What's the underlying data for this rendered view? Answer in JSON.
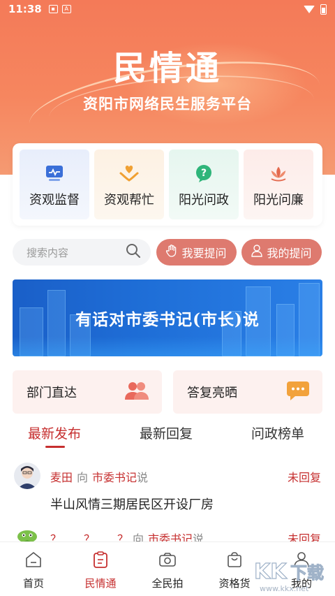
{
  "status_bar": {
    "time": "11:38",
    "icon_a": "A"
  },
  "hero": {
    "title": "民情通",
    "subtitle": "资阳市网络民生服务平台"
  },
  "services": [
    {
      "label": "资观监督",
      "icon": "monitor-wave-icon",
      "color": "#3a6fd8"
    },
    {
      "label": "资观帮忙",
      "icon": "heart-hands-icon",
      "color": "#f0a033"
    },
    {
      "label": "阳光问政",
      "icon": "question-bubble-icon",
      "color": "#2fb57a"
    },
    {
      "label": "阳光问廉",
      "icon": "lotus-icon",
      "color": "#e36a4e"
    }
  ],
  "search": {
    "placeholder": "搜索内容"
  },
  "actions": {
    "ask_label": "我要提问",
    "my_questions_label": "我的提问"
  },
  "banner": {
    "text": "有话对市委书记(市长)说"
  },
  "quick_links": [
    {
      "label": "部门直达",
      "icon": "people-icon"
    },
    {
      "label": "答复亮晒",
      "icon": "chat-dots-icon"
    }
  ],
  "tabs": [
    {
      "label": "最新发布",
      "active": true
    },
    {
      "label": "最新回复",
      "active": false
    },
    {
      "label": "问政榜单",
      "active": false
    }
  ],
  "posts": [
    {
      "author": "麦田",
      "verb": "向",
      "target": "市委书记",
      "said": "说",
      "status": "未回复",
      "content": "半山风情三期居民区开设厂房"
    },
    {
      "author": "？　　？　　？",
      "verb": "向",
      "target": "市委书记",
      "said": "说",
      "status": "未回复",
      "content": ""
    }
  ],
  "bottom_nav": [
    {
      "label": "首页",
      "icon": "home-icon",
      "active": false
    },
    {
      "label": "民情通",
      "icon": "clipboard-icon",
      "active": true
    },
    {
      "label": "全民拍",
      "icon": "camera-icon",
      "active": false
    },
    {
      "label": "资格货",
      "icon": "shopping-bag-icon",
      "active": false
    },
    {
      "label": "我的",
      "icon": "user-icon",
      "active": false
    }
  ],
  "watermark": {
    "url": "www.kkx.net"
  },
  "colors": {
    "accent": "#c62f2f",
    "hero": "#f47a58",
    "pill": "#de7a6f",
    "banner": "#1f6fd8"
  }
}
